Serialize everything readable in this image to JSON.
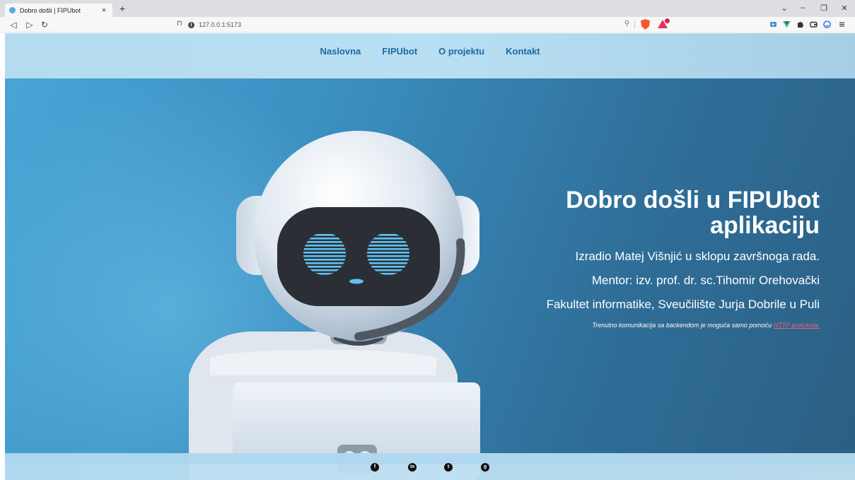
{
  "browser": {
    "tab_title": "Dobro došli | FIPUbot",
    "tab_close": "×",
    "new_tab": "+",
    "url": "127.0.0.1:5173",
    "window_controls": {
      "menu": "⌄",
      "minimize": "–",
      "restore": "❐",
      "close": "✕"
    }
  },
  "nav": {
    "items": [
      {
        "label": "Naslovna"
      },
      {
        "label": "FIPUbot"
      },
      {
        "label": "O projektu"
      },
      {
        "label": "Kontakt"
      }
    ]
  },
  "hero": {
    "title": "Dobro došli u FIPUbot aplikaciju",
    "author": "Izradio Matej Višnjić u sklopu završnoga rada.",
    "mentor": "Mentor: izv. prof. dr. sc.Tihomir Orehovački",
    "faculty": "Fakultet informatike, Sveučilište Jurja Dobrile u Puli",
    "note_prefix": "Trenutno komunikacija sa backendom je moguća samo pomoću",
    "note_link": "HTTP protokola."
  },
  "footer": {
    "social": [
      {
        "icon": "facebook-icon",
        "glyph": "f"
      },
      {
        "icon": "linkedin-icon",
        "glyph": "in"
      },
      {
        "icon": "twitter-icon",
        "glyph": "t"
      },
      {
        "icon": "github-icon",
        "glyph": "g"
      }
    ]
  },
  "colors": {
    "nav_link": "#1c6aa5",
    "hero_text": "#ffffff",
    "note_link": "#e8637a",
    "background_left": "#48a6d6",
    "background_right": "#2b5f84"
  }
}
